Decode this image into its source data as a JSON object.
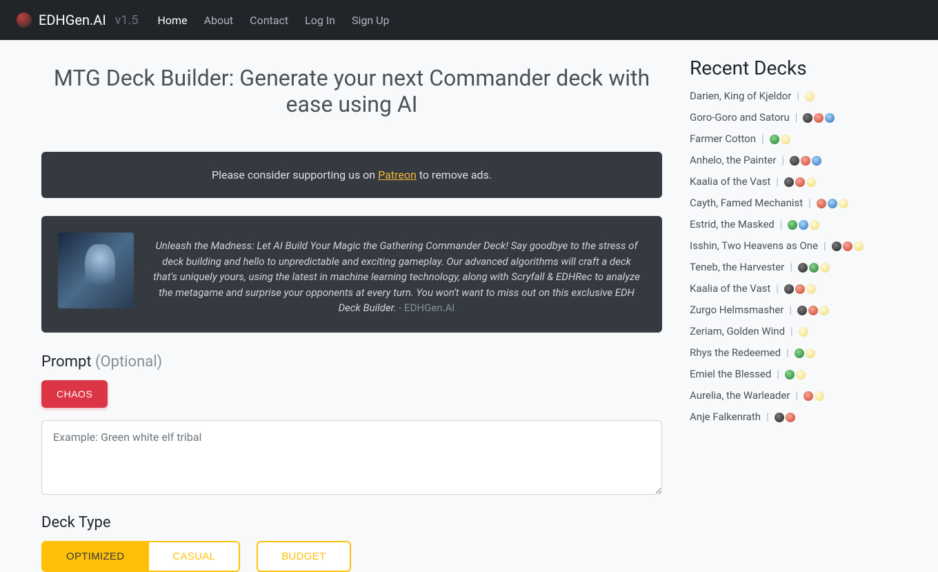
{
  "brand": {
    "name": "EDHGen.AI",
    "version": "v1.5"
  },
  "nav": {
    "items": [
      {
        "label": "Home",
        "active": true
      },
      {
        "label": "About",
        "active": false
      },
      {
        "label": "Contact",
        "active": false
      },
      {
        "label": "Log In",
        "active": false
      },
      {
        "label": "Sign Up",
        "active": false
      }
    ]
  },
  "page_title": "MTG Deck Builder: Generate your next Commander deck with ease using AI",
  "support": {
    "prefix": "Please consider supporting us on ",
    "link_label": "Patreon",
    "suffix": " to remove ads."
  },
  "intro": {
    "body": "Unleash the Madness: Let AI Build Your Magic the Gathering Commander Deck! Say goodbye to the stress of deck building and hello to unpredictable and exciting gameplay. Our advanced algorithms will craft a deck that's uniquely yours, using the latest in machine learning technology, along with Scryfall & EDHRec to analyze the metagame and surprise your opponents at every turn. You won't want to miss out on this exclusive EDH Deck Builder.",
    "attribution": " - EDHGen.AI"
  },
  "prompt": {
    "label": "Prompt ",
    "optional": "(Optional)",
    "chaos_label": "CHAOS",
    "placeholder": "Example: Green white elf tribal"
  },
  "deck_type": {
    "label": "Deck Type",
    "options": {
      "optimized": "OPTIMIZED",
      "casual": "CASUAL",
      "budget": "BUDGET"
    }
  },
  "recent": {
    "title": "Recent Decks",
    "decks": [
      {
        "name": "Darien, King of Kjeldor",
        "colors": [
          "W"
        ]
      },
      {
        "name": "Goro-Goro and Satoru",
        "colors": [
          "B",
          "R",
          "U"
        ]
      },
      {
        "name": "Farmer Cotton",
        "colors": [
          "G",
          "W"
        ]
      },
      {
        "name": "Anhelo, the Painter",
        "colors": [
          "B",
          "R",
          "U"
        ]
      },
      {
        "name": "Kaalia of the Vast",
        "colors": [
          "B",
          "R",
          "W"
        ]
      },
      {
        "name": "Cayth, Famed Mechanist",
        "colors": [
          "R",
          "U",
          "W"
        ]
      },
      {
        "name": "Estrid, the Masked",
        "colors": [
          "G",
          "U",
          "W"
        ]
      },
      {
        "name": "Isshin, Two Heavens as One",
        "colors": [
          "B",
          "R",
          "W"
        ]
      },
      {
        "name": "Teneb, the Harvester",
        "colors": [
          "B",
          "G",
          "W"
        ]
      },
      {
        "name": "Kaalia of the Vast",
        "colors": [
          "B",
          "R",
          "W"
        ]
      },
      {
        "name": "Zurgo Helmsmasher",
        "colors": [
          "B",
          "R",
          "W"
        ]
      },
      {
        "name": "Zeriam, Golden Wind",
        "colors": [
          "W"
        ]
      },
      {
        "name": "Rhys the Redeemed",
        "colors": [
          "G",
          "W"
        ]
      },
      {
        "name": "Emiel the Blessed",
        "colors": [
          "G",
          "W"
        ]
      },
      {
        "name": "Aurelia, the Warleader",
        "colors": [
          "R",
          "W"
        ]
      },
      {
        "name": "Anje Falkenrath",
        "colors": [
          "B",
          "R"
        ]
      }
    ]
  }
}
